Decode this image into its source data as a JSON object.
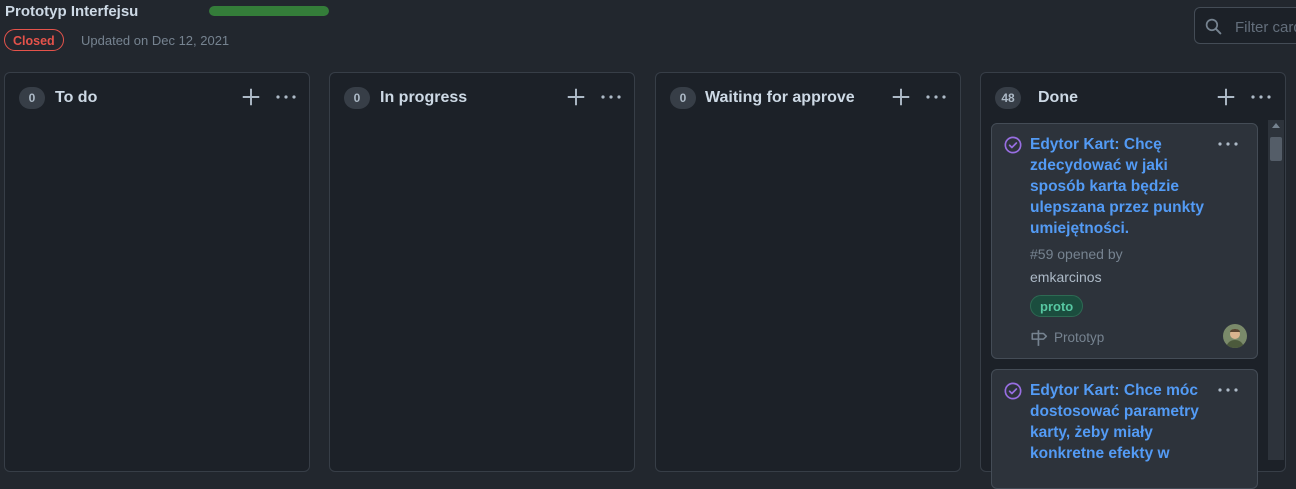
{
  "project": {
    "title": "Prototyp Interfejsu",
    "progress_fraction": 1.0,
    "state": "Closed",
    "updated": "Updated on Dec 12, 2021",
    "filter_placeholder": "Filter cards"
  },
  "colors": {
    "background": "#22272e",
    "column_bg": "#1c2128",
    "link": "#539bf5",
    "closed_red": "#e5534b",
    "progress_green": "#347d39",
    "done_purple": "#986ee2",
    "label_green": "#57c7a2"
  },
  "columns": [
    {
      "count": "0",
      "name": "To do"
    },
    {
      "count": "0",
      "name": "In progress"
    },
    {
      "count": "0",
      "name": "Waiting for approve"
    },
    {
      "count": "48",
      "name": "Done"
    }
  ],
  "cards": [
    {
      "state_icon": "issue-closed-icon",
      "title": "Edytor Kart: Chcę zdecydować w jaki sposób karta będzie ulepszana przez punkty umiejętności.",
      "meta": "#59 opened by",
      "author": "emkarcinos",
      "label": "proto",
      "milestone": "Prototyp"
    },
    {
      "state_icon": "issue-closed-icon",
      "title": "Edytor Kart: Chce móc dostosować parametry karty, żeby miały konkretne efekty w"
    }
  ]
}
